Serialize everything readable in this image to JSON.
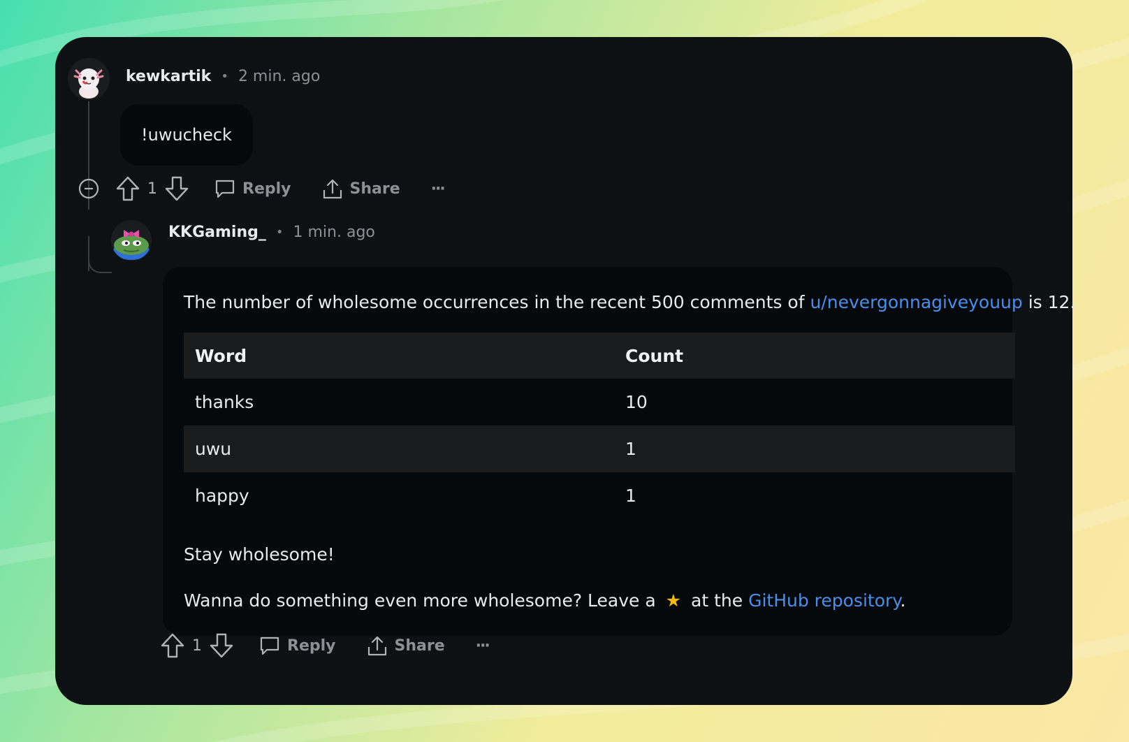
{
  "comment": {
    "username": "kewkartik",
    "time": "2 min. ago",
    "body": "!uwucheck",
    "votes": "1",
    "reply_label": "Reply",
    "share_label": "Share",
    "more_label": "···"
  },
  "reply": {
    "username": "KKGaming_",
    "time": "1 min. ago",
    "intro_text": "The number of wholesome occurrences in the recent 500 comments of",
    "intro_link": "u/nevergonnagiveyouup",
    "intro_suffix": "is 12.",
    "table": {
      "headers": [
        "Word",
        "Count"
      ],
      "rows": [
        [
          "thanks",
          "10"
        ],
        [
          "uwu",
          "1"
        ],
        [
          "happy",
          "1"
        ]
      ]
    },
    "closing": "Stay wholesome!",
    "cta_prefix": "Wanna do something even more wholesome? Leave a",
    "cta_star": "★",
    "cta_middle": "at the",
    "cta_link": "GitHub repository",
    "cta_end": ".",
    "votes": "1",
    "reply_label": "Reply",
    "share_label": "Share",
    "more_label": "···"
  },
  "colors": {
    "card_bg": "#0e1113",
    "bubble_bg": "#05090b",
    "link": "#4a8fea",
    "star": "#f5b90b",
    "muted": "#8b9196"
  }
}
